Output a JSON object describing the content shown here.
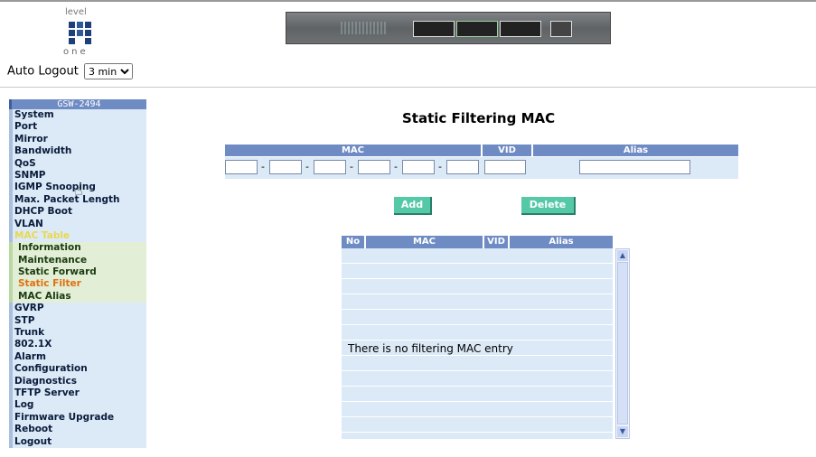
{
  "logo": {
    "top_text": "level",
    "bottom_text": "one"
  },
  "auto_logout": {
    "label": "Auto Logout",
    "selected": "3 min"
  },
  "sidebar": {
    "header": "GSW-2494",
    "items": [
      {
        "label": "System"
      },
      {
        "label": "Port"
      },
      {
        "label": "Mirror"
      },
      {
        "label": "Bandwidth"
      },
      {
        "label": "QoS"
      },
      {
        "label": "SNMP"
      },
      {
        "label": "IGMP Snooping"
      },
      {
        "label": "Max. Packet Length"
      },
      {
        "label": "DHCP Boot"
      },
      {
        "label": "VLAN"
      },
      {
        "label": "MAC Table"
      }
    ],
    "mac_sub": [
      {
        "label": "Information"
      },
      {
        "label": "Maintenance"
      },
      {
        "label": "Static Forward"
      },
      {
        "label": "Static Filter"
      },
      {
        "label": "MAC Alias"
      }
    ],
    "items_after": [
      {
        "label": "GVRP"
      },
      {
        "label": "STP"
      },
      {
        "label": "Trunk"
      },
      {
        "label": "802.1X"
      },
      {
        "label": "Alarm"
      },
      {
        "label": "Configuration"
      },
      {
        "label": "Diagnostics"
      },
      {
        "label": "TFTP Server"
      },
      {
        "label": "Log"
      },
      {
        "label": "Firmware Upgrade"
      },
      {
        "label": "Reboot"
      },
      {
        "label": "Logout"
      }
    ]
  },
  "page": {
    "title": "Static Filtering MAC",
    "form_headers": {
      "mac": "MAC",
      "vid": "VID",
      "alias": "Alias"
    },
    "add_button": "Add",
    "delete_button": "Delete",
    "list_headers": {
      "no": "No",
      "mac": "MAC",
      "vid": "VID",
      "alias": "Alias"
    },
    "empty_message": "There is no filtering MAC entry"
  },
  "colors": {
    "header_blue": "#6f8bc4",
    "row_blue": "#dbeaf6",
    "button_teal": "#55c8a8",
    "active_yellow": "#e9d84e",
    "current_orange": "#e07010"
  }
}
